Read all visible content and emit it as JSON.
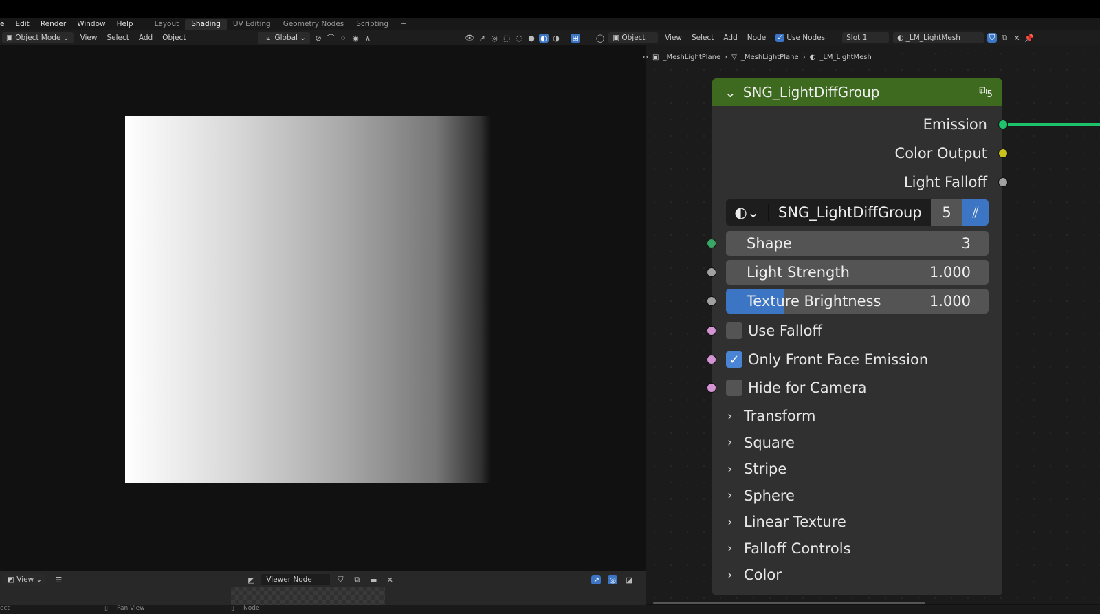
{
  "menubar": {
    "menus": [
      "e",
      "Edit",
      "Render",
      "Window",
      "Help"
    ],
    "workspaces": [
      "Layout",
      "Shading",
      "UV Editing",
      "Geometry Nodes",
      "Scripting"
    ],
    "active_workspace": "Shading",
    "add_tab": "+"
  },
  "viewport_header": {
    "mode": "Object Mode",
    "menus": [
      "View",
      "Select",
      "Add",
      "Object"
    ],
    "transform": "Global"
  },
  "node_header": {
    "object_type": "Object",
    "menus": [
      "View",
      "Select",
      "Add",
      "Node"
    ],
    "use_nodes": "Use Nodes",
    "use_nodes_checked": true,
    "slot": "Slot 1",
    "material": "_LM_LightMesh"
  },
  "breadcrumb": [
    "_MeshLightPlane",
    "_MeshLightPlane",
    "_LM_LightMesh"
  ],
  "node": {
    "title": "SNG_LightDiffGroup",
    "user_count": "5",
    "header_color": "#3e6a1f",
    "outputs": [
      {
        "label": "Emission",
        "color": "#1ec26a"
      },
      {
        "label": "Color Output",
        "color": "#c9c21c"
      },
      {
        "label": "Light Falloff",
        "color": "#a1a1a1"
      }
    ],
    "datablock": {
      "name": "SNG_LightDiffGroup",
      "users": "5"
    },
    "inputs": [
      {
        "label": "Shape",
        "value": "3",
        "color": "#3aa665"
      },
      {
        "label": "Light Strength",
        "value": "1.000",
        "color": "#a1a1a1"
      },
      {
        "label": "Texture Brightness",
        "value": "1.000",
        "color": "#a1a1a1",
        "fill": 0.22
      }
    ],
    "checkboxes": [
      {
        "label": "Use Falloff",
        "checked": false
      },
      {
        "label": "Only Front Face Emission",
        "checked": true
      },
      {
        "label": "Hide for Camera",
        "checked": false
      }
    ],
    "checkbox_socket_color": "#d494d4",
    "panels": [
      "Transform",
      "Square",
      "Stripe",
      "Sphere",
      "Linear Texture",
      "Falloff Controls",
      "Color"
    ]
  },
  "bottom": {
    "view": "View",
    "image": "Viewer Node"
  },
  "status": {
    "items": [
      "ect",
      "Pan View",
      "Node"
    ]
  }
}
